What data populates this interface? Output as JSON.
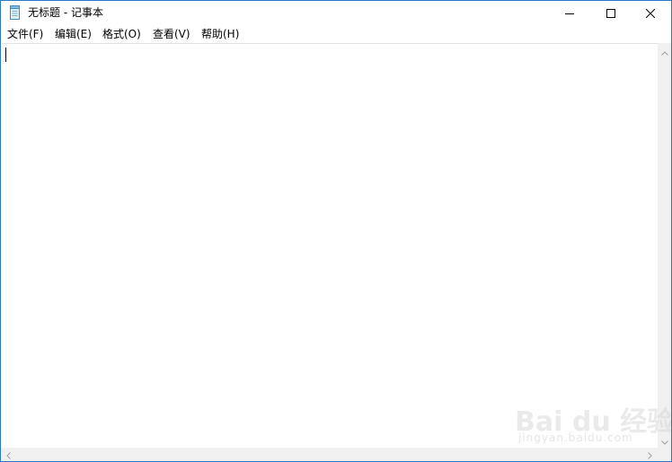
{
  "window": {
    "title": "无标题 - 记事本"
  },
  "menubar": {
    "items": [
      {
        "label": "文件(F)"
      },
      {
        "label": "编辑(E)"
      },
      {
        "label": "格式(O)"
      },
      {
        "label": "查看(V)"
      },
      {
        "label": "帮助(H)"
      }
    ]
  },
  "editor": {
    "content": ""
  },
  "watermark": {
    "brand": "Bai du 经验",
    "url": "jingyan.baidu.com"
  },
  "colors": {
    "window_border": "#2b78c4",
    "scrollbar_bg": "#f0f0f0"
  },
  "icons": [
    "notepad-icon",
    "minimize-icon",
    "maximize-icon",
    "close-icon",
    "scroll-up-icon",
    "scroll-down-icon",
    "scroll-left-icon",
    "scroll-right-icon"
  ]
}
